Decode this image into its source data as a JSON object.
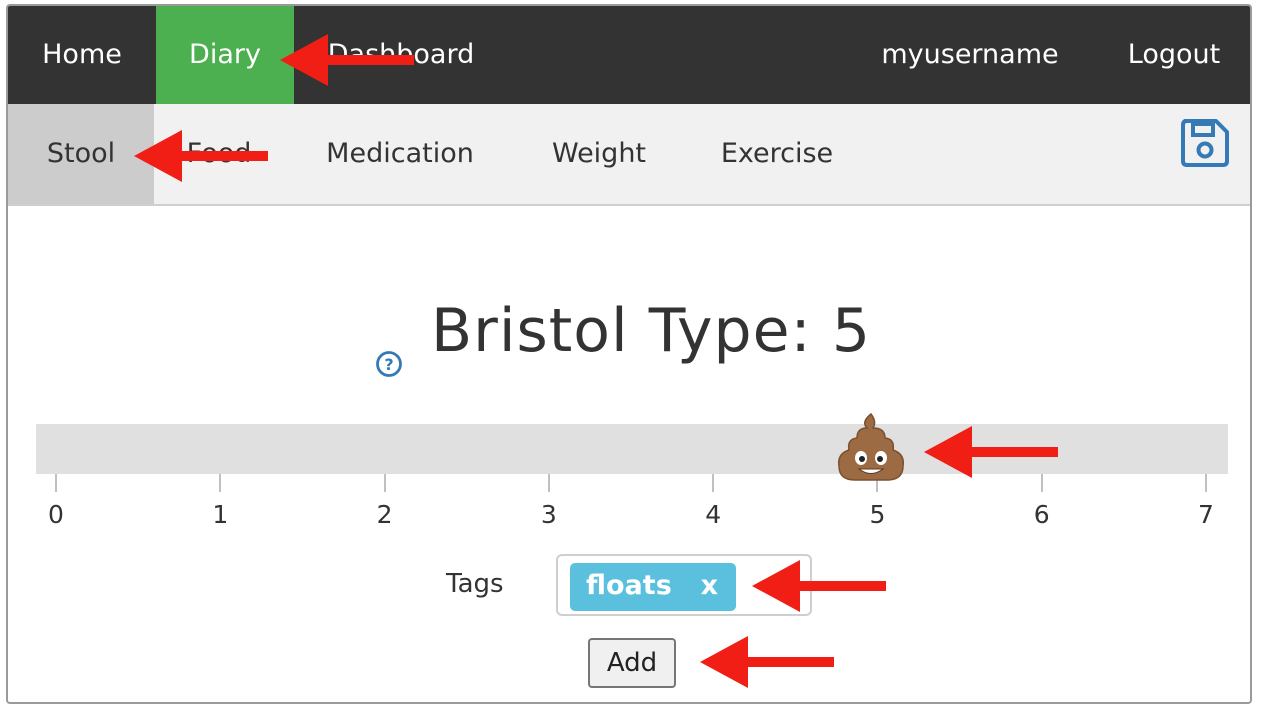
{
  "topnav": {
    "items": [
      {
        "label": "Home"
      },
      {
        "label": "Diary"
      },
      {
        "label": "Dashboard"
      }
    ],
    "user": "myusername",
    "logout": "Logout",
    "active_color": "#4caf50"
  },
  "subnav": {
    "items": [
      {
        "label": "Stool"
      },
      {
        "label": "Food"
      },
      {
        "label": "Medication"
      },
      {
        "label": "Weight"
      },
      {
        "label": "Exercise"
      }
    ],
    "save_icon": "floppy-disk-icon"
  },
  "bristol": {
    "title": "Bristol Type: 5",
    "help_icon": "question-circle-icon",
    "slider": {
      "min": 0,
      "max": 7,
      "value": 5,
      "ticks": [
        "0",
        "1",
        "2",
        "3",
        "4",
        "5",
        "6",
        "7"
      ],
      "thumb_icon": "poop-emoji-icon",
      "thumb_glyph": "💩"
    }
  },
  "tags": {
    "label": "Tags",
    "items": [
      {
        "label": "floats",
        "remove": "x"
      }
    ],
    "tag_color": "#5bc0de"
  },
  "add_button": "Add",
  "annotation_color": "#f01e14"
}
